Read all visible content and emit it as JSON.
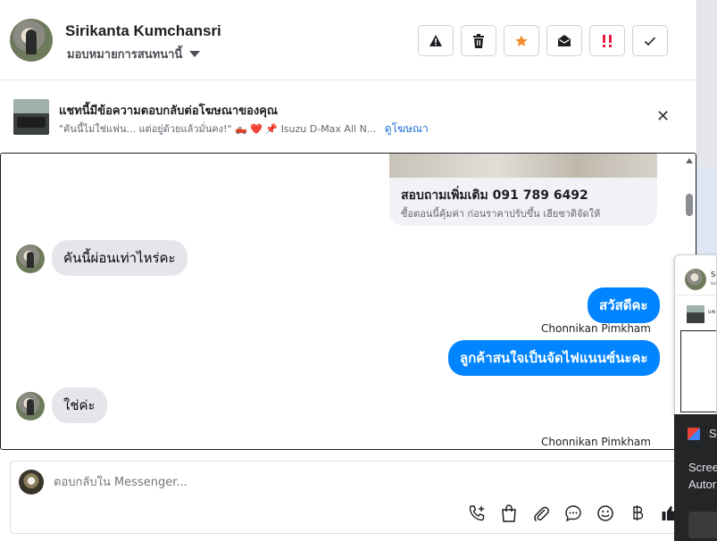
{
  "header": {
    "name": "Sirikanta Kumchansri",
    "assign_label": "มอบหมายการสนทนานี้",
    "actions": [
      {
        "icon": "warning-icon"
      },
      {
        "icon": "trash-icon"
      },
      {
        "icon": "star-icon",
        "color": "#f28c28"
      },
      {
        "icon": "envelope-open-icon"
      },
      {
        "icon": "spam-icon",
        "color": "#e41e3f"
      },
      {
        "icon": "check-icon"
      }
    ]
  },
  "ad": {
    "title": "แชทนี้มีข้อความตอบกลับต่อโฆษณาของคุณ",
    "snippet": "\"คันนี้ไม่ใช่แฟน... แต่อยู่ด้วยแล้วมั่นคง!\" 🛻 ❤️ 📌 Isuzu D-Max All N...",
    "link": "ดูโฆษณา"
  },
  "chat": {
    "card": {
      "title": "สอบถามเพิ่มเติม 091 789 6492",
      "subtitle": "ซื้อตอนนี้คุ้มค่า ก่อนราคาปรับขึ้น เฮียชาติจัดให้"
    },
    "messages": [
      {
        "text": "คันนี้ผ่อนเท่าไหร่คะ"
      },
      {
        "text": "สวัสดีคะ"
      },
      {
        "text": "Chonnikan Pimkham"
      },
      {
        "text": "ลูกค้าสนใจเป็นจัดไฟแนนซ์นะคะ"
      },
      {
        "text": "ใช่ค่ะ"
      },
      {
        "text": "Chonnikan Pimkham"
      }
    ]
  },
  "composer": {
    "placeholder": "ตอบกลับใน Messenger..."
  },
  "overlay": {
    "mini_name": "Si",
    "mini_sub": "มอ",
    "mini_ad": "แช",
    "tray_title": "S",
    "tray_line1": "Scree",
    "tray_line2": "Autor"
  }
}
